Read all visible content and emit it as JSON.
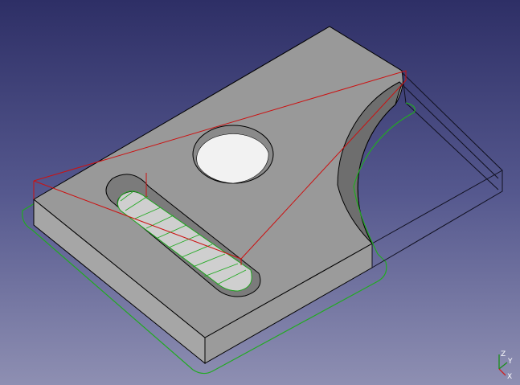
{
  "scene": {
    "part_face_color": "#9a9a9a",
    "part_side_color": "#a8a8a8",
    "edge_color": "#000000",
    "rapid_path_color": "#cc1111",
    "cut_path_color": "#22aa22",
    "stock_outline_color": "#101020"
  },
  "axis_triad": {
    "z_label": "Z",
    "y_label": "Y",
    "x_label": "X"
  }
}
